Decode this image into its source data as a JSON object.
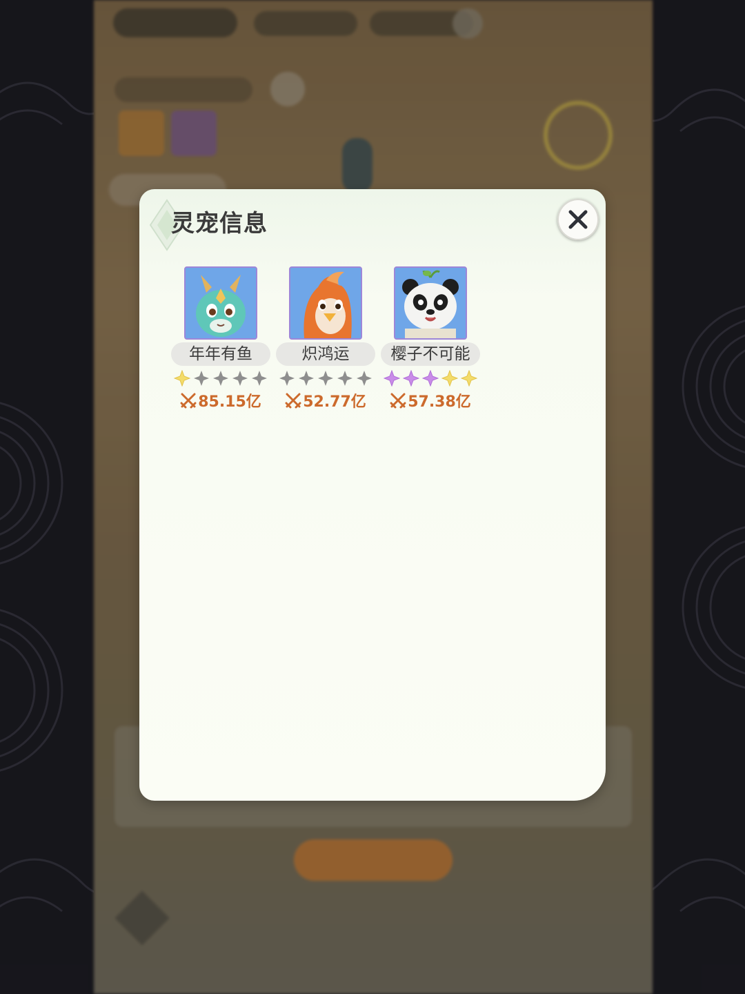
{
  "dialog": {
    "title": "灵宠信息",
    "close_icon": "close-x-icon"
  },
  "pets": [
    {
      "name": "年年有鱼",
      "portrait": "teal-dragon-pet-portrait",
      "stars": [
        "gold",
        "gray",
        "gray",
        "gray",
        "gray"
      ],
      "power": "85.15亿"
    },
    {
      "name": "炽鸿运",
      "portrait": "orange-bird-pet-portrait",
      "stars": [
        "gray",
        "gray",
        "gray",
        "gray",
        "gray"
      ],
      "power": "52.77亿"
    },
    {
      "name": "樱子不可能",
      "portrait": "panda-pet-portrait",
      "stars": [
        "purple",
        "purple",
        "purple",
        "gold",
        "gold"
      ],
      "power": "57.38亿"
    }
  ],
  "colors": {
    "star_gold": "#f3dc6a",
    "star_gray": "#8e8e8e",
    "star_purple": "#c98ce8",
    "power_text": "#cc6a2c",
    "avatar_border": "#9d86d8"
  }
}
